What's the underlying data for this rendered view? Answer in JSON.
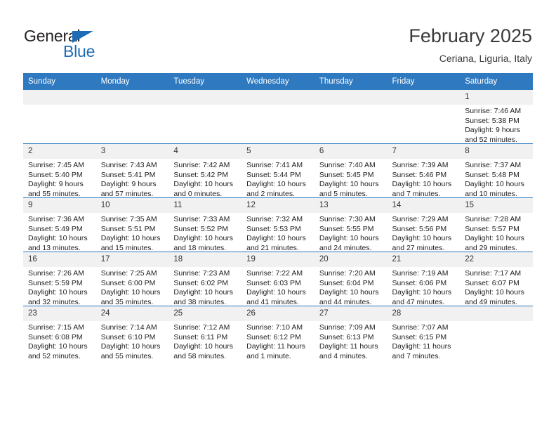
{
  "brand": {
    "name_part1": "General",
    "name_part2": "Blue",
    "accent_color": "#1d6cb5"
  },
  "header": {
    "month_title": "February 2025",
    "location": "Ceriana, Liguria, Italy"
  },
  "calendar": {
    "header_color": "#2e79c0",
    "daynum_band_color": "#f1f1f1",
    "weekday_headers": [
      "Sunday",
      "Monday",
      "Tuesday",
      "Wednesday",
      "Thursday",
      "Friday",
      "Saturday"
    ],
    "weeks": [
      [
        {
          "day": "",
          "sunrise": "",
          "sunset": "",
          "daylight": ""
        },
        {
          "day": "",
          "sunrise": "",
          "sunset": "",
          "daylight": ""
        },
        {
          "day": "",
          "sunrise": "",
          "sunset": "",
          "daylight": ""
        },
        {
          "day": "",
          "sunrise": "",
          "sunset": "",
          "daylight": ""
        },
        {
          "day": "",
          "sunrise": "",
          "sunset": "",
          "daylight": ""
        },
        {
          "day": "",
          "sunrise": "",
          "sunset": "",
          "daylight": ""
        },
        {
          "day": "1",
          "sunrise": "Sunrise: 7:46 AM",
          "sunset": "Sunset: 5:38 PM",
          "daylight": "Daylight: 9 hours and 52 minutes."
        }
      ],
      [
        {
          "day": "2",
          "sunrise": "Sunrise: 7:45 AM",
          "sunset": "Sunset: 5:40 PM",
          "daylight": "Daylight: 9 hours and 55 minutes."
        },
        {
          "day": "3",
          "sunrise": "Sunrise: 7:43 AM",
          "sunset": "Sunset: 5:41 PM",
          "daylight": "Daylight: 9 hours and 57 minutes."
        },
        {
          "day": "4",
          "sunrise": "Sunrise: 7:42 AM",
          "sunset": "Sunset: 5:42 PM",
          "daylight": "Daylight: 10 hours and 0 minutes."
        },
        {
          "day": "5",
          "sunrise": "Sunrise: 7:41 AM",
          "sunset": "Sunset: 5:44 PM",
          "daylight": "Daylight: 10 hours and 2 minutes."
        },
        {
          "day": "6",
          "sunrise": "Sunrise: 7:40 AM",
          "sunset": "Sunset: 5:45 PM",
          "daylight": "Daylight: 10 hours and 5 minutes."
        },
        {
          "day": "7",
          "sunrise": "Sunrise: 7:39 AM",
          "sunset": "Sunset: 5:46 PM",
          "daylight": "Daylight: 10 hours and 7 minutes."
        },
        {
          "day": "8",
          "sunrise": "Sunrise: 7:37 AM",
          "sunset": "Sunset: 5:48 PM",
          "daylight": "Daylight: 10 hours and 10 minutes."
        }
      ],
      [
        {
          "day": "9",
          "sunrise": "Sunrise: 7:36 AM",
          "sunset": "Sunset: 5:49 PM",
          "daylight": "Daylight: 10 hours and 13 minutes."
        },
        {
          "day": "10",
          "sunrise": "Sunrise: 7:35 AM",
          "sunset": "Sunset: 5:51 PM",
          "daylight": "Daylight: 10 hours and 15 minutes."
        },
        {
          "day": "11",
          "sunrise": "Sunrise: 7:33 AM",
          "sunset": "Sunset: 5:52 PM",
          "daylight": "Daylight: 10 hours and 18 minutes."
        },
        {
          "day": "12",
          "sunrise": "Sunrise: 7:32 AM",
          "sunset": "Sunset: 5:53 PM",
          "daylight": "Daylight: 10 hours and 21 minutes."
        },
        {
          "day": "13",
          "sunrise": "Sunrise: 7:30 AM",
          "sunset": "Sunset: 5:55 PM",
          "daylight": "Daylight: 10 hours and 24 minutes."
        },
        {
          "day": "14",
          "sunrise": "Sunrise: 7:29 AM",
          "sunset": "Sunset: 5:56 PM",
          "daylight": "Daylight: 10 hours and 27 minutes."
        },
        {
          "day": "15",
          "sunrise": "Sunrise: 7:28 AM",
          "sunset": "Sunset: 5:57 PM",
          "daylight": "Daylight: 10 hours and 29 minutes."
        }
      ],
      [
        {
          "day": "16",
          "sunrise": "Sunrise: 7:26 AM",
          "sunset": "Sunset: 5:59 PM",
          "daylight": "Daylight: 10 hours and 32 minutes."
        },
        {
          "day": "17",
          "sunrise": "Sunrise: 7:25 AM",
          "sunset": "Sunset: 6:00 PM",
          "daylight": "Daylight: 10 hours and 35 minutes."
        },
        {
          "day": "18",
          "sunrise": "Sunrise: 7:23 AM",
          "sunset": "Sunset: 6:02 PM",
          "daylight": "Daylight: 10 hours and 38 minutes."
        },
        {
          "day": "19",
          "sunrise": "Sunrise: 7:22 AM",
          "sunset": "Sunset: 6:03 PM",
          "daylight": "Daylight: 10 hours and 41 minutes."
        },
        {
          "day": "20",
          "sunrise": "Sunrise: 7:20 AM",
          "sunset": "Sunset: 6:04 PM",
          "daylight": "Daylight: 10 hours and 44 minutes."
        },
        {
          "day": "21",
          "sunrise": "Sunrise: 7:19 AM",
          "sunset": "Sunset: 6:06 PM",
          "daylight": "Daylight: 10 hours and 47 minutes."
        },
        {
          "day": "22",
          "sunrise": "Sunrise: 7:17 AM",
          "sunset": "Sunset: 6:07 PM",
          "daylight": "Daylight: 10 hours and 49 minutes."
        }
      ],
      [
        {
          "day": "23",
          "sunrise": "Sunrise: 7:15 AM",
          "sunset": "Sunset: 6:08 PM",
          "daylight": "Daylight: 10 hours and 52 minutes."
        },
        {
          "day": "24",
          "sunrise": "Sunrise: 7:14 AM",
          "sunset": "Sunset: 6:10 PM",
          "daylight": "Daylight: 10 hours and 55 minutes."
        },
        {
          "day": "25",
          "sunrise": "Sunrise: 7:12 AM",
          "sunset": "Sunset: 6:11 PM",
          "daylight": "Daylight: 10 hours and 58 minutes."
        },
        {
          "day": "26",
          "sunrise": "Sunrise: 7:10 AM",
          "sunset": "Sunset: 6:12 PM",
          "daylight": "Daylight: 11 hours and 1 minute."
        },
        {
          "day": "27",
          "sunrise": "Sunrise: 7:09 AM",
          "sunset": "Sunset: 6:13 PM",
          "daylight": "Daylight: 11 hours and 4 minutes."
        },
        {
          "day": "28",
          "sunrise": "Sunrise: 7:07 AM",
          "sunset": "Sunset: 6:15 PM",
          "daylight": "Daylight: 11 hours and 7 minutes."
        },
        {
          "day": "",
          "sunrise": "",
          "sunset": "",
          "daylight": ""
        }
      ]
    ]
  }
}
